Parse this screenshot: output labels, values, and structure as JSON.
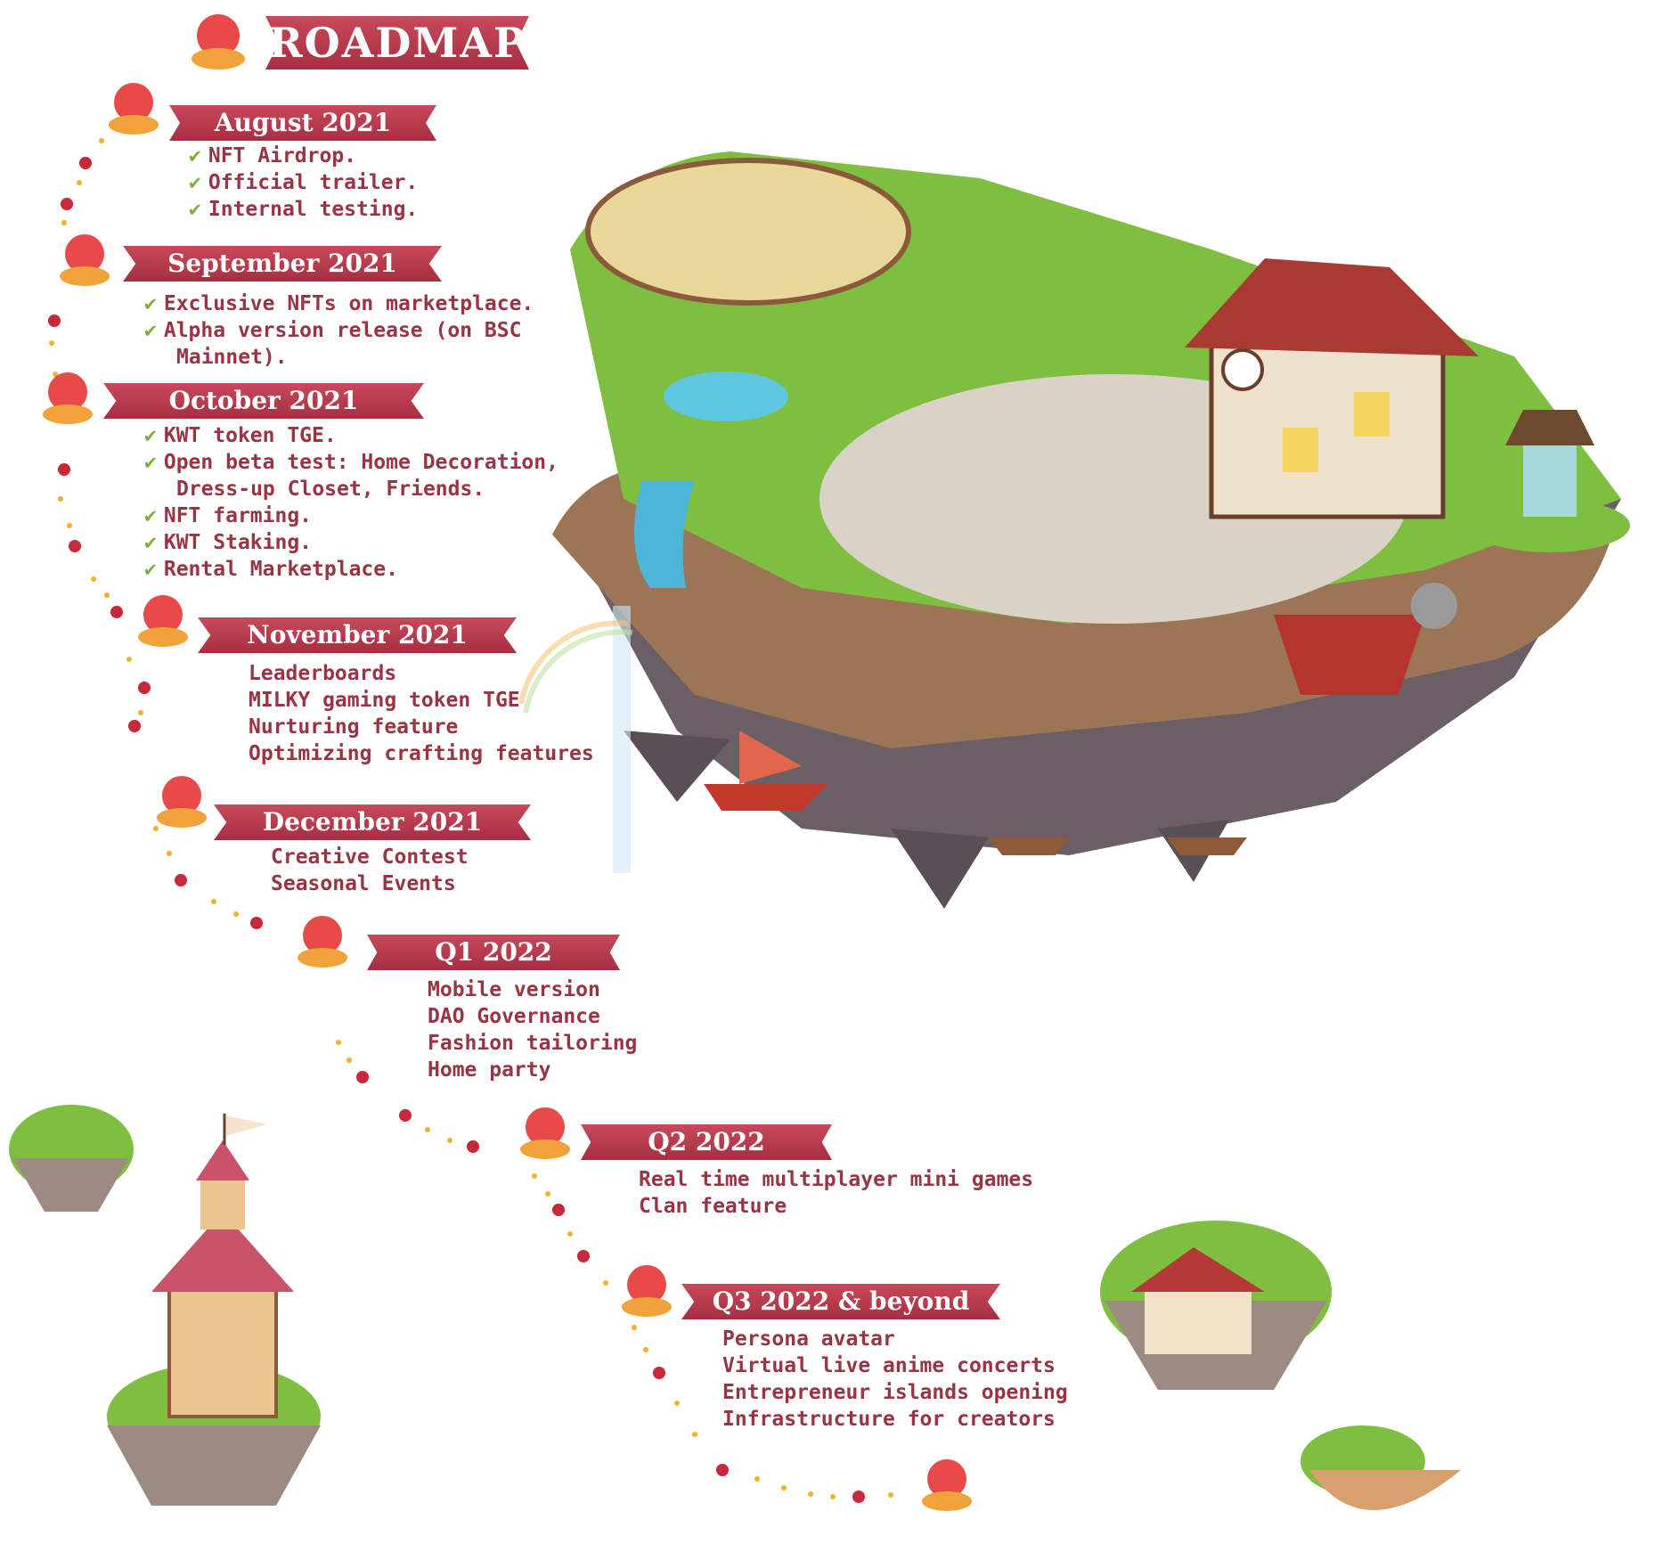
{
  "roadmap": {
    "title": "ROADMAP",
    "milestones": [
      {
        "period": "August 2021",
        "items": [
          {
            "text": "NFT Airdrop.",
            "done": true
          },
          {
            "text": "Official trailer.",
            "done": true
          },
          {
            "text": "Internal testing.",
            "done": true
          }
        ]
      },
      {
        "period": "September 2021",
        "items": [
          {
            "text": "Exclusive NFTs on marketplace.",
            "done": true
          },
          {
            "text": "Alpha version release (on BSC",
            "done": true
          },
          {
            "text": "Mainnet).",
            "done": true,
            "continuation": true
          }
        ]
      },
      {
        "period": "October 2021",
        "items": [
          {
            "text": "KWT token TGE.",
            "done": true
          },
          {
            "text": "Open beta test: Home Decoration,",
            "done": true
          },
          {
            "text": "Dress-up Closet, Friends.",
            "done": true,
            "continuation": true
          },
          {
            "text": "NFT farming.",
            "done": true
          },
          {
            "text": "KWT Staking.",
            "done": true
          },
          {
            "text": "Rental Marketplace.",
            "done": true
          }
        ]
      },
      {
        "period": "November 2021",
        "items": [
          {
            "text": "Leaderboards",
            "done": false
          },
          {
            "text": "MILKY gaming token TGE",
            "done": false
          },
          {
            "text": "Nurturing feature",
            "done": false
          },
          {
            "text": "Optimizing crafting features",
            "done": false
          }
        ]
      },
      {
        "period": "December 2021",
        "items": [
          {
            "text": "Creative Contest",
            "done": false
          },
          {
            "text": "Seasonal Events",
            "done": false
          }
        ]
      },
      {
        "period": "Q1 2022",
        "items": [
          {
            "text": "Mobile version",
            "done": false
          },
          {
            "text": "DAO Governance",
            "done": false
          },
          {
            "text": "Fashion tailoring",
            "done": false
          },
          {
            "text": "Home party",
            "done": false
          }
        ]
      },
      {
        "period": "Q2 2022",
        "items": [
          {
            "text": "Real time multiplayer mini games",
            "done": false
          },
          {
            "text": "Clan feature",
            "done": false
          }
        ]
      },
      {
        "period": "Q3 2022 & beyond",
        "items": [
          {
            "text": "Persona avatar",
            "done": false
          },
          {
            "text": "Virtual live anime concerts",
            "done": false
          },
          {
            "text": "Entrepreneur islands opening",
            "done": false
          },
          {
            "text": "Infrastructure for creators",
            "done": false
          }
        ]
      }
    ]
  },
  "icons": {
    "check": "✔",
    "mascot": "mascot-icon",
    "bead": "bead-icon"
  },
  "colors": {
    "ribbon": "#b8394c",
    "text": "#9a3343",
    "check": "#7fae3c",
    "grass": "#7fbf3f",
    "rock": "#8a7a6e"
  }
}
